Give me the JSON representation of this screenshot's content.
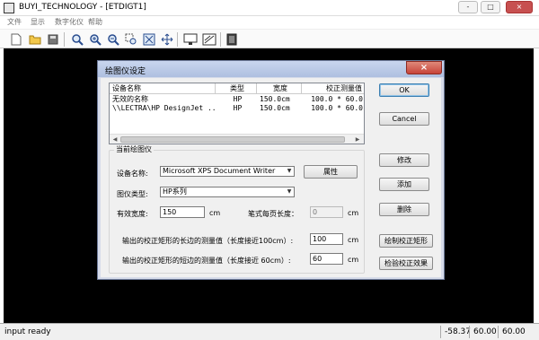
{
  "window": {
    "title": "BUYI_TECHNOLOGY - [ETDIGT1]",
    "controls": {
      "minimize": "-",
      "maximize": "□",
      "close": "×"
    }
  },
  "menubar": {
    "items": [
      "文件",
      "显示",
      "数字化仪",
      "帮助"
    ]
  },
  "toolbar": {
    "icons": [
      "new-file-icon",
      "open-folder-icon",
      "save-disk-icon",
      "zoom-fit-icon",
      "zoom-in-icon",
      "zoom-out-icon",
      "zoom-window-icon",
      "zoom-all-icon",
      "pan-icon",
      "digitizer-icon",
      "plotter-icon",
      "calculator-icon"
    ]
  },
  "status": {
    "text": "input ready",
    "x": "-58.37",
    "y": "60.00",
    "value": "60.00"
  },
  "dialog": {
    "title": "绘图仪设定",
    "close": "×",
    "list": {
      "columns": [
        "设备名称",
        "类型",
        "宽度",
        "校正测量值"
      ],
      "rows": [
        [
          "无效的名称",
          "HP",
          "150.0cm",
          "100.0 * 60.0"
        ],
        [
          "\\\\LECTRA\\HP DesignJet ...",
          "HP",
          "150.0cm",
          "100.0 * 60.0"
        ]
      ],
      "scroll_left": "◀",
      "scroll_right": "▶"
    },
    "current": {
      "group_title": "当前绘图仪",
      "device_label": "设备名称:",
      "device_value": "Microsoft XPS Document Writer",
      "properties_button": "属性",
      "type_label": "图仪类型:",
      "type_value": "HP系列",
      "width_label": "有效宽度:",
      "width_value": "150",
      "width_unit": "cm",
      "page_length_label": "笔式每页长度：",
      "page_length_value": "0",
      "page_length_unit": "cm",
      "long_side_label": "输出的校正矩形的长边的测量值（长度接近100cm）:",
      "long_side_value": "100",
      "long_side_unit": "cm",
      "short_side_label": "输出的校正矩形的短边的测量值（长度接近 60cm）:",
      "short_side_value": "60",
      "short_side_unit": "cm",
      "arrow": "▼"
    },
    "buttons": {
      "ok": "OK",
      "cancel": "Cancel",
      "modify": "修改",
      "add": "添加",
      "delete": "删除",
      "plot_rect": "绘制校正矩形",
      "check_result": "检验校正效果"
    }
  }
}
